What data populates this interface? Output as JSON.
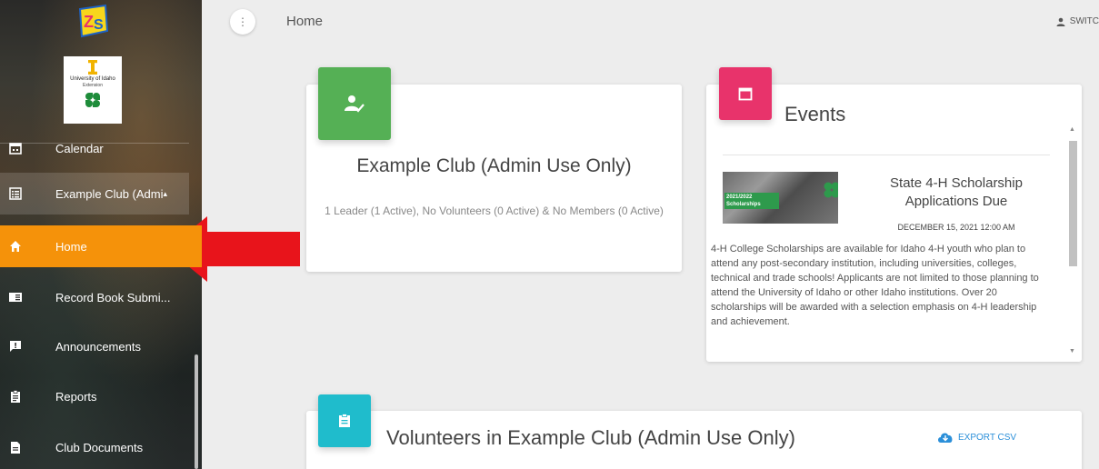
{
  "sidebar": {
    "nav": [
      {
        "label": "Calendar",
        "icon": "calendar-icon"
      },
      {
        "label": "Example Club (Admi",
        "icon": "list-icon",
        "suffix": "▴"
      },
      {
        "label": "Home",
        "icon": "home-icon"
      },
      {
        "label": "Record Book Submi...",
        "icon": "book-icon"
      },
      {
        "label": "Announcements",
        "icon": "announcement-icon"
      },
      {
        "label": "Reports",
        "icon": "clipboard-icon"
      },
      {
        "label": "Club Documents",
        "icon": "document-icon"
      }
    ],
    "logo_text": {
      "university": "University of Idaho",
      "extension": "Extension"
    }
  },
  "header": {
    "title": "Home",
    "switch_label": "SWITC"
  },
  "club_card": {
    "title": "Example Club (Admin Use Only)",
    "summary": "1 Leader (1 Active), No Volunteers (0 Active) & No Members (0 Active)"
  },
  "events_card": {
    "title": "Events",
    "event": {
      "image_text": "2021/2022 Scholarships",
      "title": "State 4-H Scholarship Applications Due",
      "date": "DECEMBER 15, 2021 12:00 AM",
      "description": "4-H College Scholarships are available for Idaho 4-H youth who plan to attend any post-secondary institution, including universities, colleges, technical and trade schools! Applicants are not limited to those planning to attend the University of Idaho or other Idaho institutions. Over 20 scholarships will be awarded with a selection emphasis on 4-H leadership and achievement."
    }
  },
  "volunteers_card": {
    "title": "Volunteers in Example Club (Admin Use Only)",
    "export_label": "EXPORT CSV"
  },
  "colors": {
    "active_nav": "#f5920a",
    "club_badge": "#55b055",
    "events_badge": "#e8336b",
    "volunteers_badge": "#1fbccc",
    "arrow": "#e8141b",
    "export": "#2b8fd9"
  }
}
